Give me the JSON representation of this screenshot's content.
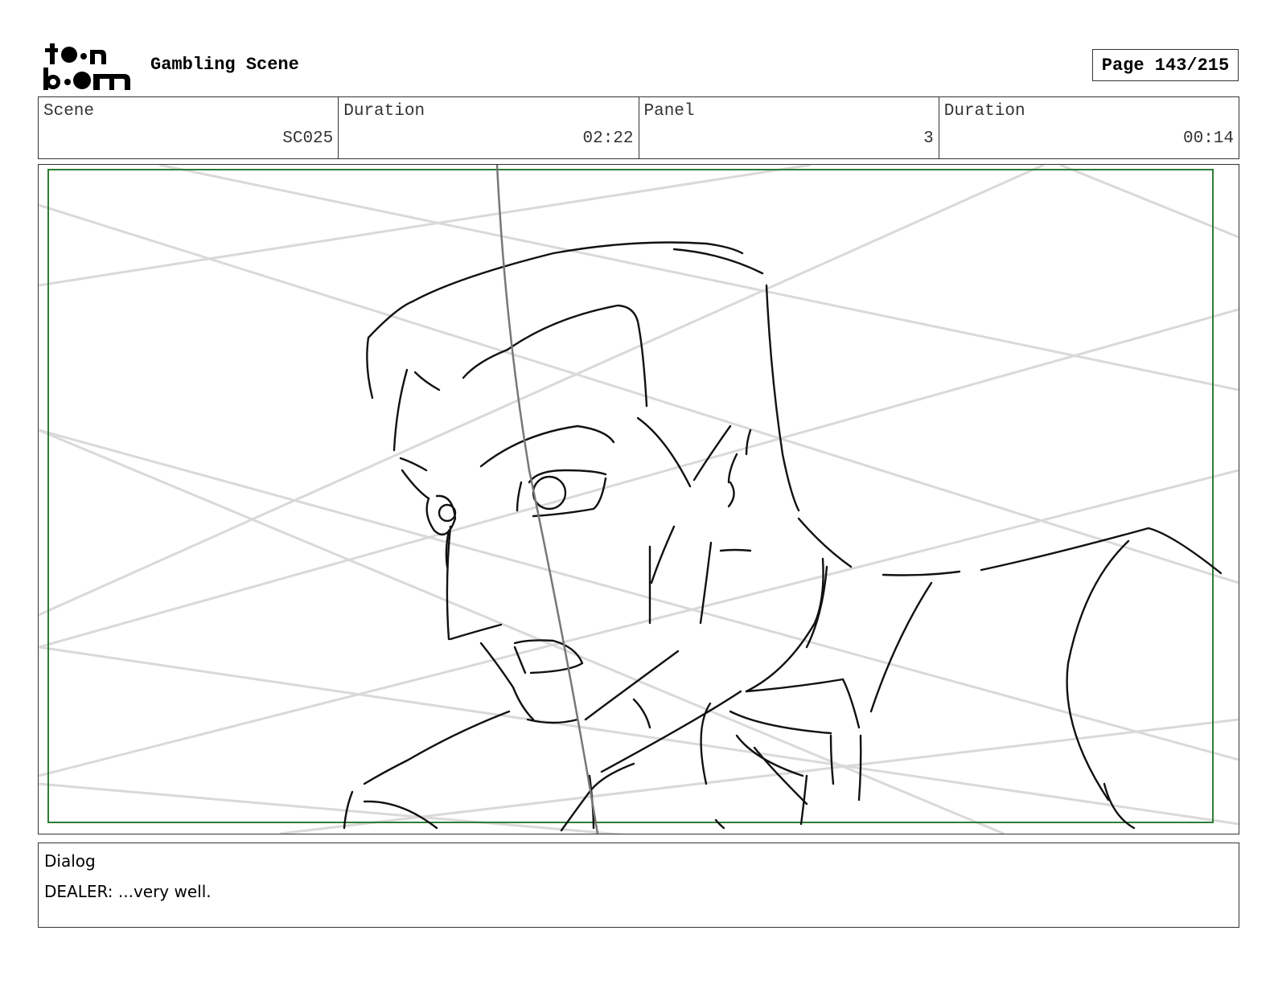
{
  "header": {
    "logo_line1": "toon",
    "logo_line2": "boom",
    "title": "Gambling Scene",
    "page": "Page 143/215"
  },
  "info": [
    {
      "label": "Scene",
      "value": "SC025"
    },
    {
      "label": "Duration",
      "value": "02:22"
    },
    {
      "label": "Panel",
      "value": "3"
    },
    {
      "label": "Duration",
      "value": "00:14"
    }
  ],
  "panel": {
    "safe_frame_color": "#2e7d32",
    "sketch_color": "#111111",
    "guide_color": "#d9d9d9"
  },
  "dialog": {
    "label": "Dialog",
    "text": "DEALER: ...very well."
  }
}
